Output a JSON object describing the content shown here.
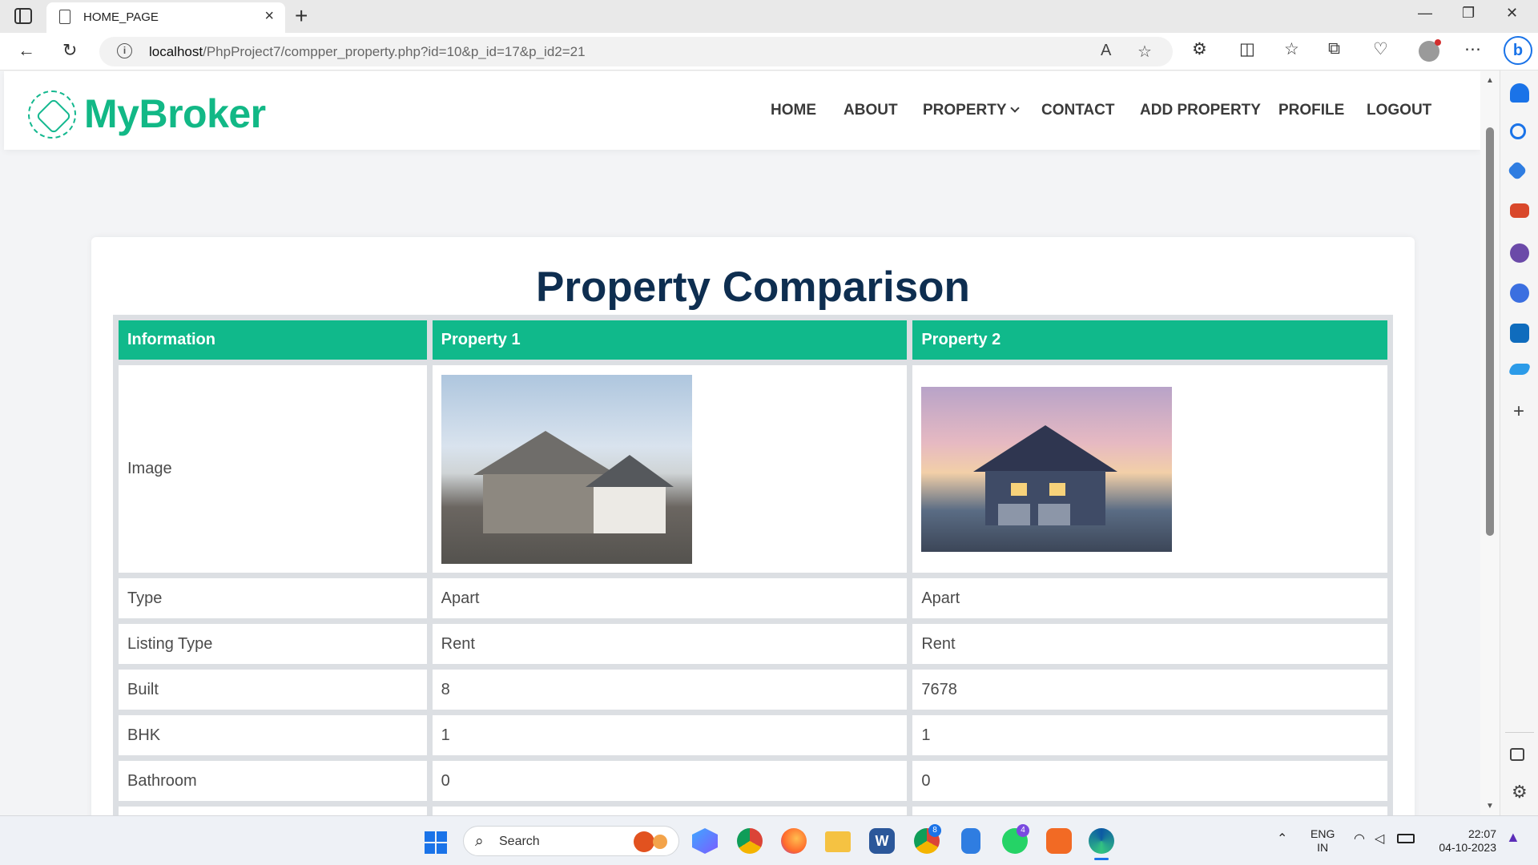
{
  "browser": {
    "tab_title": "HOME_PAGE",
    "url_host": "localhost",
    "url_path": "/PhpProject7/compper_property.php?id=10&p_id=17&p_id2=21"
  },
  "site": {
    "logo": "MyBroker",
    "nav": {
      "home": "HOME",
      "about": "ABOUT",
      "property": "PROPERTY",
      "contact": "CONTACT",
      "add_property": "ADD PROPERTY",
      "profile": "PROFILE",
      "logout": "LOGOUT"
    }
  },
  "comparison": {
    "title": "Property Comparison",
    "headers": [
      "Information",
      "Property 1",
      "Property 2"
    ],
    "image_label": "Image",
    "rows": [
      {
        "label": "Type",
        "p1": "Apart",
        "p2": "Apart"
      },
      {
        "label": "Listing Type",
        "p1": "Rent",
        "p2": "Rent"
      },
      {
        "label": "Built",
        "p1": "8",
        "p2": "7678"
      },
      {
        "label": "BHK",
        "p1": "1",
        "p2": "1"
      },
      {
        "label": "Bathroom",
        "p1": "0",
        "p2": "0"
      }
    ]
  },
  "taskbar": {
    "search": "Search",
    "lang_top": "ENG",
    "lang_bottom": "IN",
    "time": "22:07",
    "date": "04-10-2023",
    "chrome_badge": "8",
    "whatsapp_badge": "4"
  },
  "colors": {
    "accent": "#10b98b",
    "title": "#0e2e50"
  }
}
